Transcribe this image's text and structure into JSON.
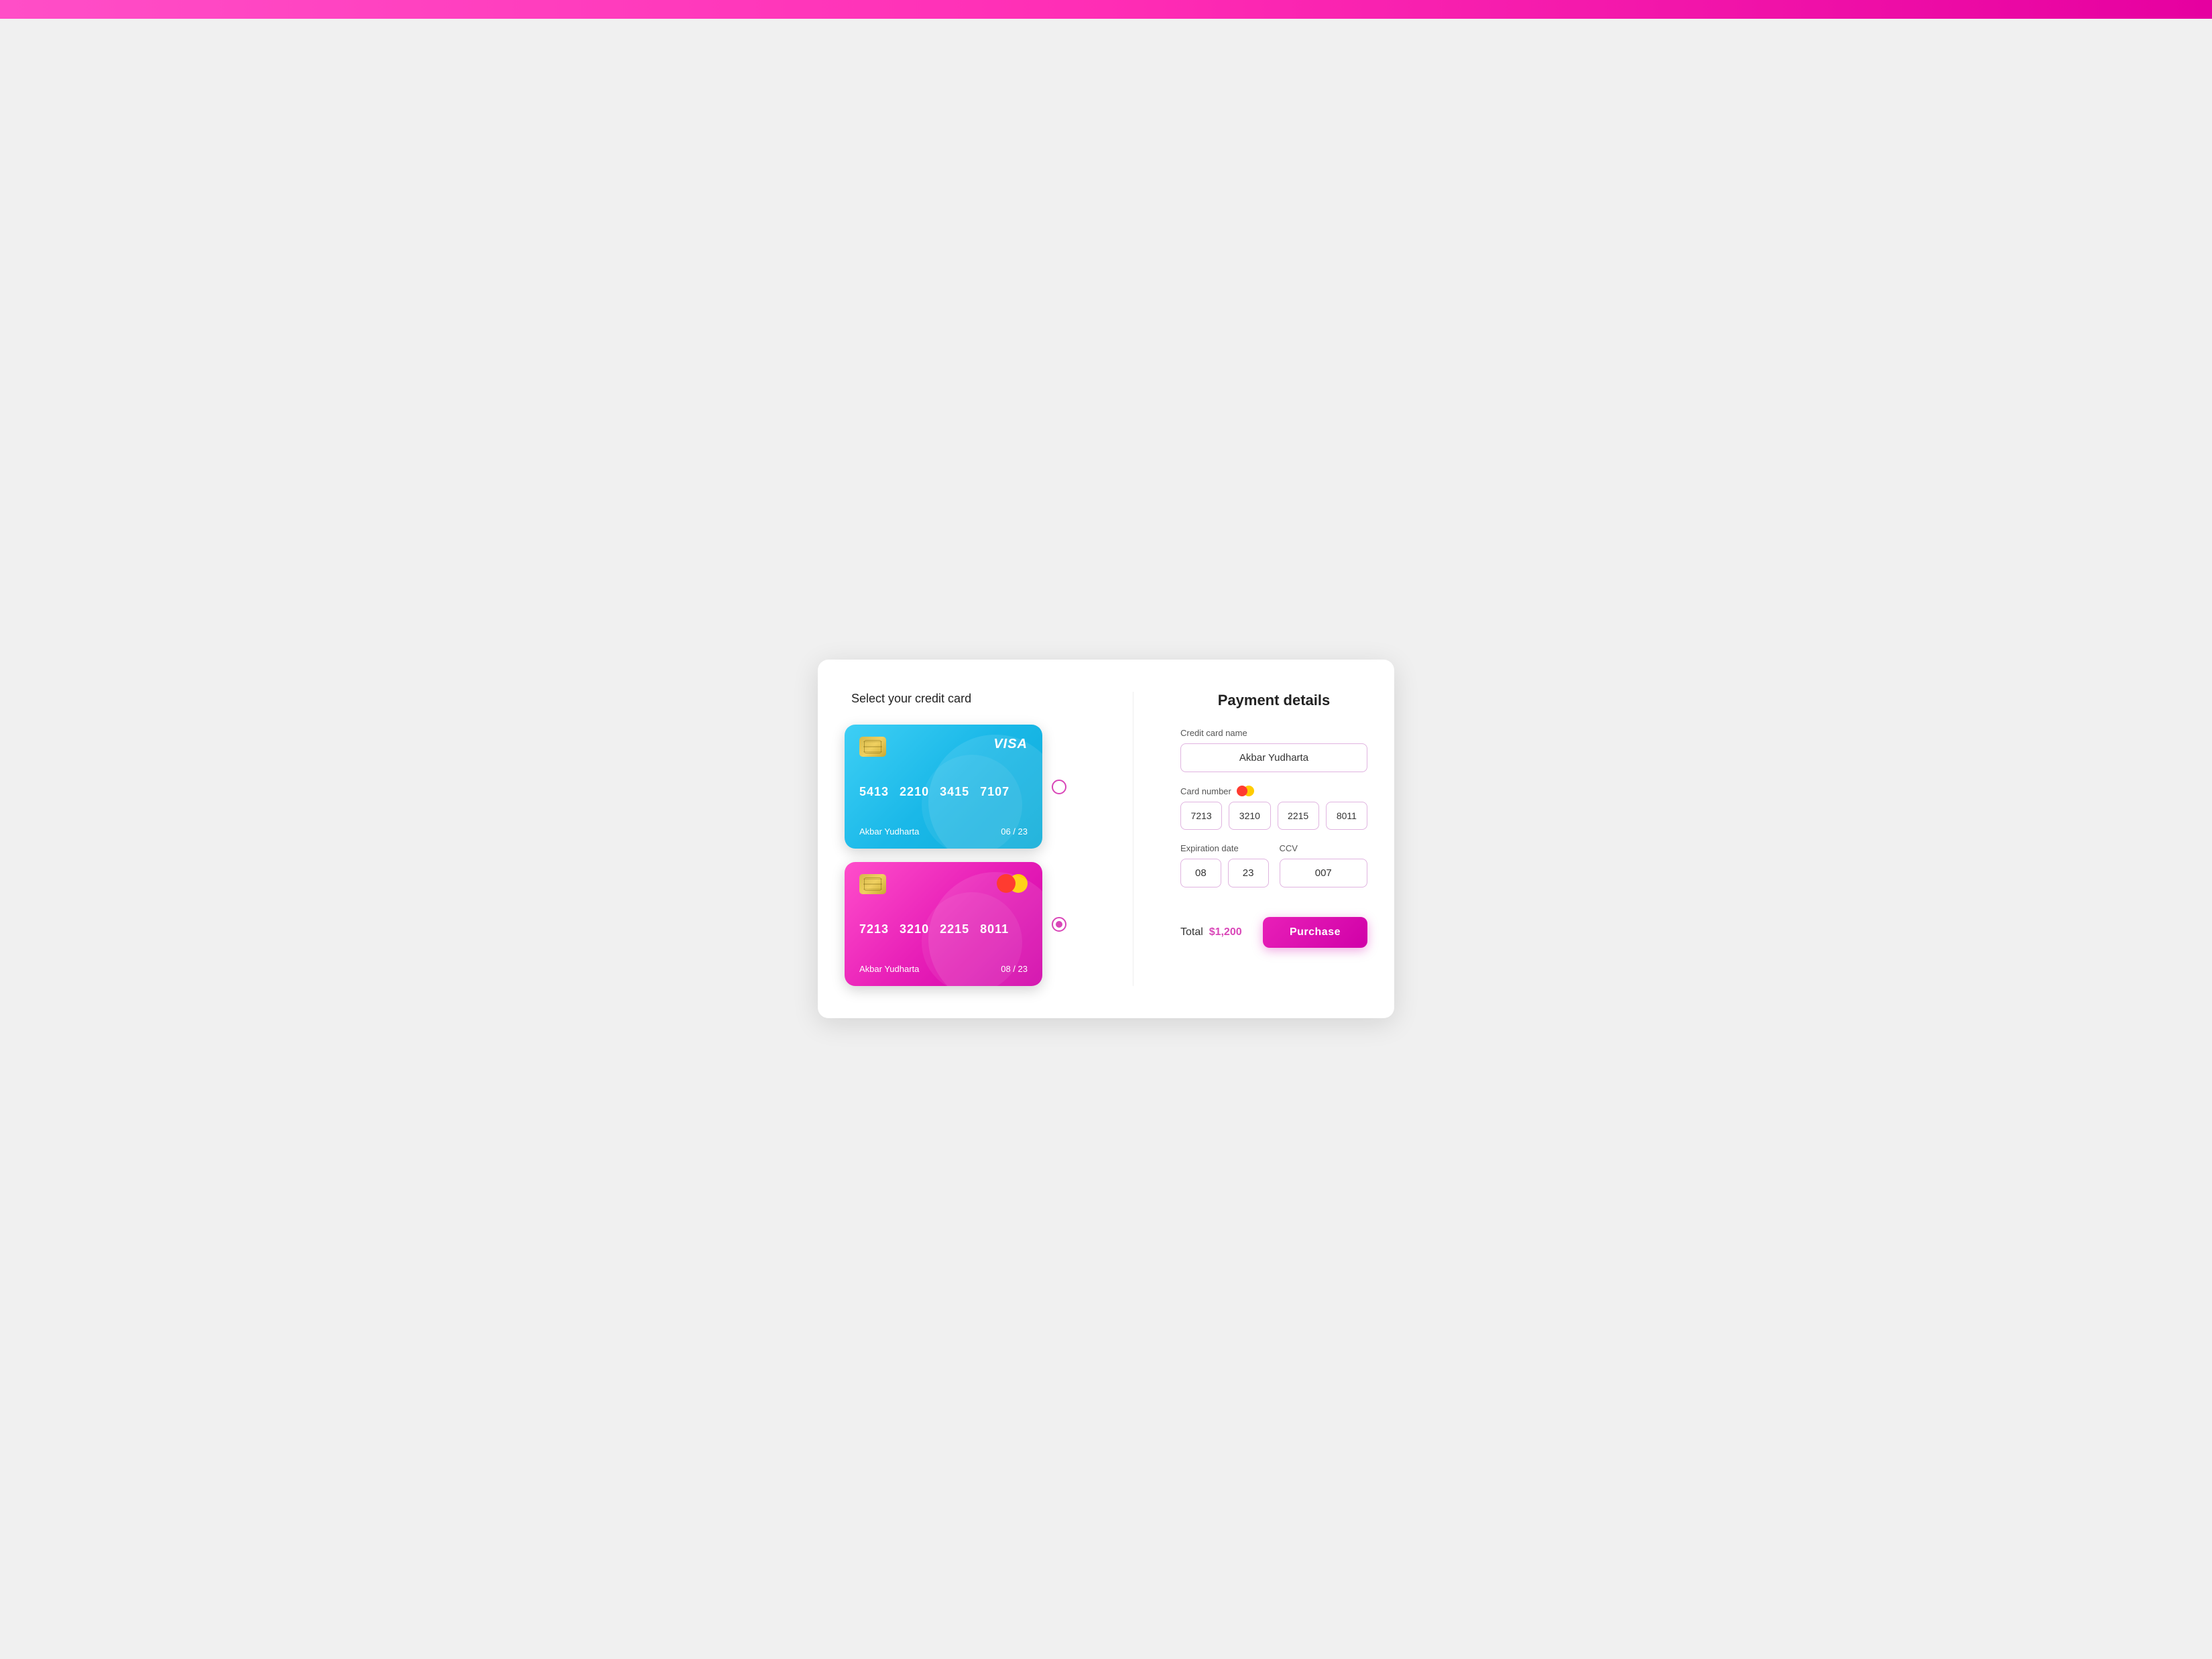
{
  "topbar": {
    "color": "#e600a0"
  },
  "left": {
    "title": "Select your credit card",
    "cards": [
      {
        "id": "visa",
        "type": "visa",
        "number": [
          "5413",
          "2210",
          "3415",
          "7107"
        ],
        "holder": "Akbar Yudharta",
        "expiry": "06 / 23",
        "logo": "VISA",
        "selected": false
      },
      {
        "id": "mastercard",
        "type": "mastercard",
        "number": [
          "7213",
          "3210",
          "2215",
          "8011"
        ],
        "holder": "Akbar Yudharta",
        "expiry": "08 / 23",
        "selected": true
      }
    ]
  },
  "right": {
    "title": "Payment details",
    "fields": {
      "credit_card_name_label": "Credit card name",
      "credit_card_name_value": "Akbar Yudharta",
      "card_number_label": "Card number",
      "card_number_parts": [
        "7213",
        "3210",
        "2215",
        "8011"
      ],
      "expiration_date_label": "Expiration date",
      "expiry_month": "08",
      "expiry_year": "23",
      "ccv_label": "CCV",
      "ccv_value": "007"
    },
    "total_label": "Total",
    "total_amount": "$1,200",
    "purchase_label": "Purchase"
  }
}
